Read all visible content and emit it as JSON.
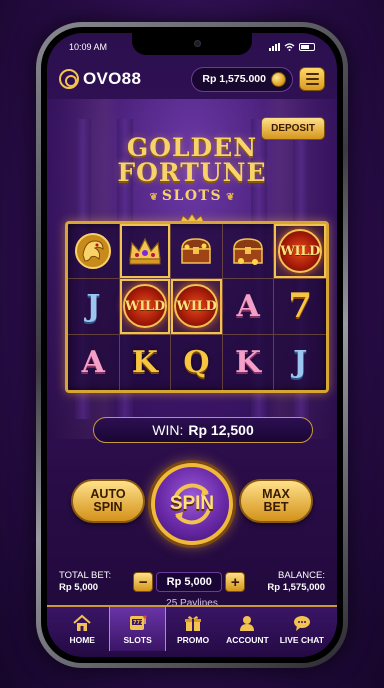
{
  "status_bar": {
    "time": "10:09 AM"
  },
  "header": {
    "logo_text": "OVO88",
    "balance": "Rp 1,575.000",
    "deposit_label": "DEPOSIT"
  },
  "game": {
    "title_line1": "GOLDEN",
    "title_line2": "FORTUNE",
    "subtitle": "SLOTS"
  },
  "reels": [
    [
      "dragon",
      "crown",
      "chest",
      "chest",
      "WILD"
    ],
    [
      "J",
      "WILD",
      "WILD",
      "A",
      "7"
    ],
    [
      "A",
      "K",
      "Q",
      "K",
      "J"
    ]
  ],
  "win": {
    "label": "WIN:",
    "value": "Rp 12,500"
  },
  "controls": {
    "auto_spin_line1": "AUTO",
    "auto_spin_line2": "SPIN",
    "spin_label": "SPIN",
    "max_bet_line1": "MAX",
    "max_bet_line2": "BET"
  },
  "bet": {
    "total_bet_label": "TOTAL BET:",
    "total_bet_value": "Rp 5,000",
    "stake_value": "Rp 5,000",
    "minus_symbol": "−",
    "plus_symbol": "+",
    "balance_label": "BALANCE:",
    "balance_value": "Rp 1,575,000",
    "paylines": "25 Paylines"
  },
  "nav": [
    {
      "label": "HOME",
      "icon": "home-icon"
    },
    {
      "label": "SLOTS",
      "icon": "slot-machine-icon",
      "active": true
    },
    {
      "label": "PROMO",
      "icon": "gift-icon"
    },
    {
      "label": "ACCOUNT",
      "icon": "user-icon"
    },
    {
      "label": "LIVE CHAT",
      "icon": "chat-icon"
    }
  ],
  "colors": {
    "gold": "#f2c350",
    "purple": "#3a1566",
    "accent_red": "#e84a1c"
  }
}
